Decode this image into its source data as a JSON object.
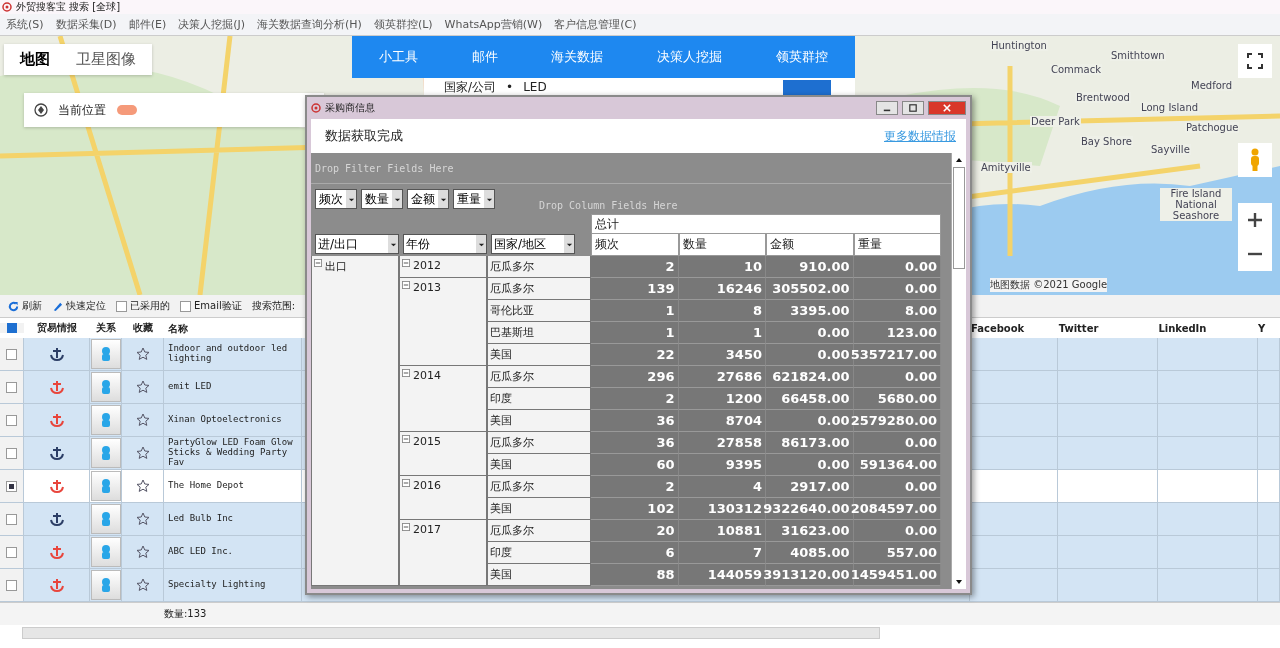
{
  "window": {
    "title": "外贸搜客宝 搜索 [全球]"
  },
  "menu": [
    "系统(S)",
    "数据采集(D)",
    "邮件(E)",
    "决策人挖掘(J)",
    "海关数据查询分析(H)",
    "领英群控(L)",
    "WhatsApp营销(W)",
    "客户信息管理(C)"
  ],
  "map": {
    "tabs": [
      {
        "label": "地图",
        "selected": true
      },
      {
        "label": "卫星图像",
        "selected": false
      }
    ],
    "location": "当前位置",
    "nav": [
      "小工具",
      "邮件",
      "海关数据",
      "决策人挖掘",
      "领英群控"
    ],
    "search": {
      "label": "国家/公司",
      "separator": "•",
      "value": "LED"
    },
    "labels": [
      "Huntington",
      "Smithtown",
      "Commack",
      "Medford",
      "Brentwood",
      "Long Island",
      "Deer Park",
      "Patchogue",
      "Bay Shore",
      "Sayville",
      "Amityville",
      "Fire Island National Seashore"
    ],
    "attribution": "地图数据 ©2021 Google"
  },
  "toolbar": {
    "refresh": "刷新",
    "locate": "快速定位",
    "checks": [
      {
        "label": "已采用的",
        "checked": false
      },
      {
        "label": "Email验证",
        "checked": false
      }
    ],
    "scope": "搜索范围:"
  },
  "table": {
    "columns": [
      "贸易情报",
      "关系",
      "收藏",
      "名称",
      "Facebook",
      "Twitter",
      "LinkedIn",
      "Y"
    ],
    "rows": [
      {
        "checked": false,
        "selected": false,
        "color": "#2c3e66",
        "name": "Indoor and outdoor led lighting"
      },
      {
        "checked": false,
        "selected": false,
        "color": "#e8453c",
        "name": "emit LED"
      },
      {
        "checked": false,
        "selected": false,
        "color": "#e8453c",
        "name": "Xinan Optoelectronics"
      },
      {
        "checked": false,
        "selected": false,
        "color": "#2c3e66",
        "name": "PartyGlow LED Foam Glow Sticks & Wedding Party Fav"
      },
      {
        "checked": true,
        "selected": true,
        "color": "#e8453c",
        "name": "The Home Depot"
      },
      {
        "checked": false,
        "selected": false,
        "color": "#2c3e66",
        "name": "Led Bulb Inc"
      },
      {
        "checked": false,
        "selected": false,
        "color": "#e8453c",
        "name": "ABC LED Inc."
      },
      {
        "checked": false,
        "selected": false,
        "color": "#e8453c",
        "name": "Specialty Lighting"
      }
    ],
    "count": "数量:133"
  },
  "dialog": {
    "title": "采购商信息",
    "heading": "数据获取完成",
    "link": "更多数据情报",
    "filter_drop": "Drop Filter Fields Here",
    "column_drop": "Drop Column Fields Here",
    "data_fields": [
      "频次",
      "数量",
      "金额",
      "重量"
    ],
    "row_fields": [
      "进/出口",
      "年份",
      "国家/地区"
    ],
    "total": "总计",
    "column_headers": [
      "频次",
      "数量",
      "金额",
      "重量"
    ],
    "rows": [
      {
        "label": "出口",
        "expanded": true,
        "children": [
          {
            "label": "2012",
            "expanded": true,
            "children": [
              {
                "label": "厄瓜多尔",
                "values": [
                  "2",
                  "10",
                  "910.00",
                  "0.00"
                ]
              }
            ]
          },
          {
            "label": "2013",
            "expanded": true,
            "children": [
              {
                "label": "厄瓜多尔",
                "values": [
                  "139",
                  "16246",
                  "305502.00",
                  "0.00"
                ]
              },
              {
                "label": "哥伦比亚",
                "values": [
                  "1",
                  "8",
                  "3395.00",
                  "8.00"
                ]
              },
              {
                "label": "巴基斯坦",
                "values": [
                  "1",
                  "1",
                  "0.00",
                  "123.00"
                ]
              },
              {
                "label": "美国",
                "values": [
                  "22",
                  "3450",
                  "0.00",
                  "5357217.00"
                ]
              }
            ]
          },
          {
            "label": "2014",
            "expanded": true,
            "children": [
              {
                "label": "厄瓜多尔",
                "values": [
                  "296",
                  "27686",
                  "621824.00",
                  "0.00"
                ]
              },
              {
                "label": "印度",
                "values": [
                  "2",
                  "1200",
                  "66458.00",
                  "5680.00"
                ]
              },
              {
                "label": "美国",
                "values": [
                  "36",
                  "8704",
                  "0.00",
                  "2579280.00"
                ]
              }
            ]
          },
          {
            "label": "2015",
            "expanded": true,
            "children": [
              {
                "label": "厄瓜多尔",
                "values": [
                  "36",
                  "27858",
                  "86173.00",
                  "0.00"
                ]
              },
              {
                "label": "美国",
                "values": [
                  "60",
                  "9395",
                  "0.00",
                  "591364.00"
                ]
              }
            ]
          },
          {
            "label": "2016",
            "expanded": true,
            "children": [
              {
                "label": "厄瓜多尔",
                "values": [
                  "2",
                  "4",
                  "2917.00",
                  "0.00"
                ]
              },
              {
                "label": "美国",
                "values": [
                  "102",
                  "130312",
                  "9322640.00",
                  "2084597.00"
                ]
              }
            ]
          },
          {
            "label": "2017",
            "expanded": true,
            "children": [
              {
                "label": "厄瓜多尔",
                "values": [
                  "20",
                  "10881",
                  "31623.00",
                  "0.00"
                ]
              },
              {
                "label": "印度",
                "values": [
                  "6",
                  "7",
                  "4085.00",
                  "557.00"
                ]
              },
              {
                "label": "美国",
                "values": [
                  "88",
                  "144059",
                  "3913120.00",
                  "1459451.00"
                ]
              }
            ]
          }
        ]
      }
    ]
  }
}
